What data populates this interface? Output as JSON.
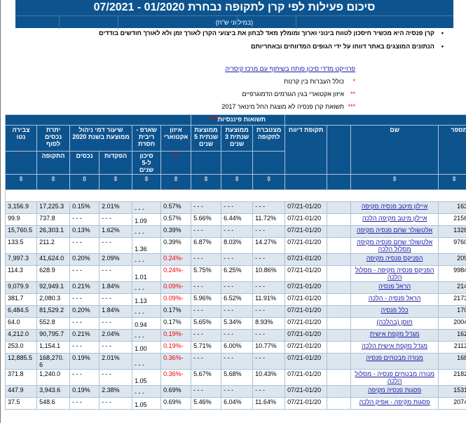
{
  "title": "סיכום פעילות לפי קרן לתקופה נבחרת 01/2020 - 07/2021",
  "subtitle": "(במיליוני ש\"ח)",
  "bullets": [
    "קרן פנסיה היא מכשיר חיסכון לטווח בינוני וארוך ומומלץ מאד לבחון את ביצועי הקרן לאורך זמן ולא לאורך חודשים בודדים",
    "הנתונים המוצגים באתר דווחו על ידי הגופים המדווחים ובאחריותם"
  ],
  "link": "פרוייקט מדדי סיכון פותח בשיתוף עם מרכז קיסריה",
  "notes": [
    {
      "mark": "*",
      "text": "כולל העברות בין קרנות"
    },
    {
      "mark": "**",
      "text": "איזון אקטוארי בגין הגורמים הדמוגרפיים"
    },
    {
      "mark": "***",
      "text": "תשואת קרן פנסיה לא מוצגת החל מינואר 2017"
    }
  ],
  "table": {
    "group_header": "תשואות פיננסיות",
    "group_mark": "***",
    "headers": {
      "number": "מספר",
      "name": "שם",
      "period": "תקופת דיווח",
      "cumulative": "מצטברת לתקופה",
      "avg3": "ממוצעת שנתית 3 שנים",
      "avg5": "ממוצעת שנתית 5 שנים",
      "actuarial": "איזון אקטוארי",
      "actuarial_mark": "**",
      "sharpe": "שארפ - ריבית חסרת",
      "sharpe_sub": "סיכון ל-5 שנים",
      "mgmt": "שיעור דמי ניהול ממוצעת בשנת 2020",
      "deposits": "הפקדות",
      "assets": "נכסים",
      "balance": "יתרת נכסים לסוף",
      "balance_sub": "התקופה",
      "net": "צבירה נטו",
      "net_mark": "*"
    },
    "sort_icon": "sort-arrows-icon",
    "rows": [
      [
        "163",
        "איילון מיטב פנסיה מקיפה",
        "07/21-01/20",
        "---",
        "---",
        "---",
        "0.57%",
        "---",
        "2.01%",
        "0.15%",
        "17,225.3",
        "3,156.9"
      ],
      [
        "2156",
        "איילון מיטב מקיפה הלכה",
        "07/21-01/20",
        "11.72%",
        "6.44%",
        "5.66%",
        "0.57%",
        "1.09",
        "---",
        "---",
        "737.8",
        "99.9"
      ],
      [
        "1328",
        "אלטשולר שחם פנסיה מקיפה",
        "07/21-01/20",
        "---",
        "---",
        "---",
        "0.39%",
        "---",
        "1.62%",
        "0.13%",
        "26,303.1",
        "15,760.5"
      ],
      [
        "9760",
        "אלטשולר שחם פנסיה מקיפה מסלול הלכה",
        "07/21-01/20",
        "14.27%",
        "8.03%",
        "6.87%",
        "0.39%",
        "1.36",
        "---",
        "---",
        "211.2",
        "133.5"
      ],
      [
        "209",
        "הפניקס פנסיה מקיפה",
        "07/21-01/20",
        "---",
        "---",
        "---",
        "-0.24%",
        "---",
        "2.09%",
        "0.20%",
        "41,624.0",
        "7,997.3"
      ],
      [
        "9984",
        "הפניקס פנסיה מקיפה - מסלול הלכה",
        "07/21-01/20",
        "10.86%",
        "6.25%",
        "5.75%",
        "-0.24%",
        "1.01",
        "---",
        "---",
        "628.9",
        "114.3"
      ],
      [
        "214",
        "הראל פנסיה",
        "07/21-01/20",
        "---",
        "---",
        "---",
        "-0.09%",
        "---",
        "1.84%",
        "0.21%",
        "92,949.1",
        "9,079.9"
      ],
      [
        "2173",
        "הראל פנסיה - הלכה",
        "07/21-01/20",
        "11.91%",
        "6.52%",
        "5.96%",
        "-0.09%",
        "1.13",
        "---",
        "---",
        "2,080.3",
        "381.7"
      ],
      [
        "170",
        "כלל פנסיה",
        "07/21-01/20",
        "---",
        "---",
        "---",
        "0.17%",
        "---",
        "1.84%",
        "0.20%",
        "81,529.2",
        "6,484.5"
      ],
      [
        "2004",
        "חוסן (בהלכה)",
        "07/21-01/20",
        "8.93%",
        "5.34%",
        "5.65%",
        "0.17%",
        "0.94",
        "---",
        "---",
        "552.8",
        "64.0"
      ],
      [
        "162",
        "מגדל מקפת אישית",
        "07/21-01/20",
        "---",
        "---",
        "---",
        "-0.19%",
        "---",
        "2.04%",
        "0.21%",
        "90,795.7",
        "4,212.0"
      ],
      [
        "2112",
        "מגדל מקפת אישית הלכה",
        "07/21-01/20",
        "10.77%",
        "6.00%",
        "5.71%",
        "-0.19%",
        "1.00",
        "---",
        "---",
        "1,154.1",
        "253.0"
      ],
      [
        "168",
        "מנורה מבטחים פנסיה",
        "07/21-01/20",
        "---",
        "---",
        "---",
        "-0.36%",
        "---",
        "2.01%",
        "0.19%",
        "168,270.6",
        "12,885.5"
      ],
      [
        "2182",
        "מנורה מבטחים פנסיה - מסלול הלכה",
        "07/21-01/20",
        "10.43%",
        "5.68%",
        "5.67%",
        "-0.36%",
        "1.05",
        "---",
        "---",
        "1,240.0",
        "371.8"
      ],
      [
        "1531",
        "פסגות פנסיה מקיפה",
        "07/21-01/20",
        "---",
        "---",
        "---",
        "0.69%",
        "---",
        "2.38%",
        "0.19%",
        "3,943.6",
        "447.9"
      ],
      [
        "2074",
        "פסגות מקיפה - אפיק הלכה",
        "07/21-01/20",
        "11.64%",
        "6.04%",
        "5.46%",
        "0.69%",
        "1.05",
        "---",
        "---",
        "548.6",
        "37.5"
      ]
    ]
  },
  "colors": {
    "header": "#0d548f",
    "row_alt": "#dde6ef",
    "negative": "#e00000",
    "link": "#1a1aa6"
  }
}
